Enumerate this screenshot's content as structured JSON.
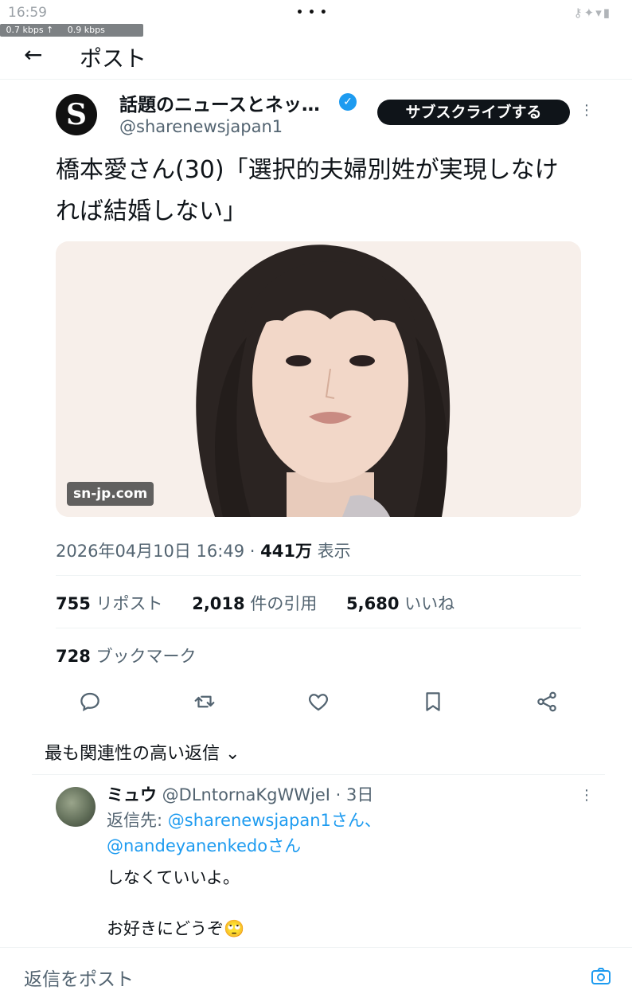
{
  "status_bar": {
    "time": "16:59",
    "dots": "•••",
    "net_speed": " 0.7 kbps ↑     0.9 kbps",
    "icons": "⚷✦▾▮"
  },
  "header": {
    "back_icon": "←",
    "title": "ポスト"
  },
  "author": {
    "avatar_letter": "S",
    "name": "話題のニュースとネッ…",
    "verified": "✓",
    "handle": "@sharenewsjapan1",
    "subscribe": "サブスクライブする"
  },
  "tweet": {
    "text": "橋本愛さん(30)「選択的夫婦別姓が実現しなければ結婚しない」",
    "image_watermark": "sn-jp.com",
    "date": "2026年04月10日 16:49 · ",
    "views_count": "441万",
    "views_label": " 表示"
  },
  "stats": {
    "reposts_count": "755",
    "reposts_label": " リポスト",
    "quotes_count": "2,018",
    "quotes_label": " 件の引用",
    "likes_count": "5,680",
    "likes_label": " いいね",
    "bookmarks_count": "728",
    "bookmarks_label": " ブックマーク"
  },
  "actions": [
    "reply-icon",
    "repost-icon",
    "like-icon",
    "bookmark-icon",
    "share-icon"
  ],
  "sort_label": "最も関連性の高い返信 ⌄",
  "reply": {
    "name": "ミュウ",
    "handle_date": " @DLntornaKgWWjeI · 3日",
    "to_label": "返信先: ",
    "mention1": "@sharenewsjapan1さん、",
    "mention2": "@nandeyanenkedoさん",
    "body": "しなくていいよ。\n\nお好きにどうぞ🙄"
  },
  "compose": {
    "placeholder": "返信をポスト"
  },
  "colors": {
    "accent": "#1d9bf0",
    "text_primary": "#0f1419",
    "text_secondary": "#536471"
  }
}
